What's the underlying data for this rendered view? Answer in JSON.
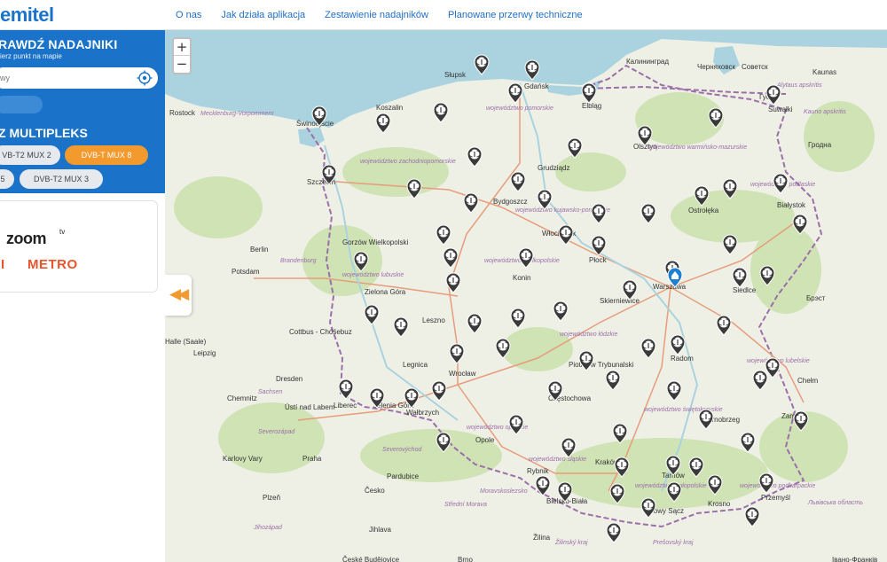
{
  "brand": {
    "logo": "emitel"
  },
  "nav": [
    "O nas",
    "Jak działa aplikacja",
    "Zestawienie nadajników",
    "Planowane przerwy techniczne"
  ],
  "sidebar": {
    "title": "RAWDŹ NADAJNIKI",
    "subtitle": "ierz punkt na mapie",
    "search_value": "wy",
    "search_button": "",
    "mux_title": "Z MULTIPLEKS",
    "mux_buttons": [
      {
        "label": "VB-T2 MUX 2",
        "active": false
      },
      {
        "label": "DVB-T MUX 8",
        "active": true
      },
      {
        "label": "5",
        "active": false
      },
      {
        "label": "DVB-T2 MUX 3",
        "active": false
      }
    ],
    "channels": {
      "zoom": "zoom",
      "zoom_tv": "tv",
      "metro": "METRO",
      "partial": "I"
    }
  },
  "map": {
    "zoom_in": "+",
    "zoom_out": "−",
    "collapse_icon": "chevron-double-left-icon",
    "colors": {
      "marker": "#3a3a3a",
      "home": "#1f7fd0",
      "border": "#9c6fa8",
      "water": "#aad3df",
      "land": "#eef0e6",
      "forest": "#cfe3b5",
      "road": "#e79c7b"
    },
    "labels": [
      "Słupsk",
      "Gdańsk",
      "Elbląg",
      "Калининград",
      "Черняховск",
      "Советск",
      "Гусев",
      "Suwałki",
      "Alytaus apskritis",
      "Kauno apskritis",
      "Kaunas",
      "Гродна",
      "Rostock",
      "Mecklenburg-Vorpommern",
      "Świnoujście",
      "Koszalin",
      "województwo pomorskie",
      "województwo zachodniopomorskie",
      "Olsztyn",
      "województwo warmińsko-mazurskie",
      "Szczecin",
      "Grudziądz",
      "Bydgoszcz",
      "województwo kujawsko-pomorskie",
      "Ostrołęka",
      "województwo podlaskie",
      "Białystok",
      "Gorzów Wielkopolski",
      "Berlin",
      "Brandenburg",
      "Potsdam",
      "Włocławek",
      "Płock",
      "województwo lubuskie",
      "województwo wielkopolskie",
      "Konin",
      "Warszawa",
      "Skierniewice",
      "Siedlce",
      "Брэст",
      "Zielona Góra",
      "Cottbus - Chóśebuz",
      "Leszno",
      "województwo łódzkie",
      "Halle (Saale)",
      "Leipzig",
      "Radom",
      "województwo lubelskie",
      "Legnica",
      "Wrocław",
      "Piotrków Trybunalski",
      "Dresden",
      "Sachsen",
      "Chemnitz",
      "Ústí nad Labem",
      "Liberec",
      "Jelenia Góra",
      "Wałbrzych",
      "Częstochowa",
      "województwo świętokrzyskie",
      "Chełm",
      "Tarnobrzeg",
      "Zamość",
      "województwo opolskie",
      "Opole",
      "Severozápad",
      "województwo śląskie",
      "Karlovy Vary",
      "Praha",
      "Severovýchod",
      "Pardubice",
      "Kraków",
      "Rybnik",
      "Tarnów",
      "województwo małopolskie",
      "województwo podkarpackie",
      "Przemyśl",
      "Львівська область",
      "Plzeň",
      "Česko",
      "Moravskoslezsko",
      "Bielsko-Biała",
      "Krosno",
      "Nowy Sącz",
      "Střední Morava",
      "Jihozápad",
      "Jihlava",
      "Žilina",
      "Žilinský kraj",
      "Prešovský kraj",
      "České Budějovice",
      "Brno",
      "Івано-Франків"
    ]
  }
}
